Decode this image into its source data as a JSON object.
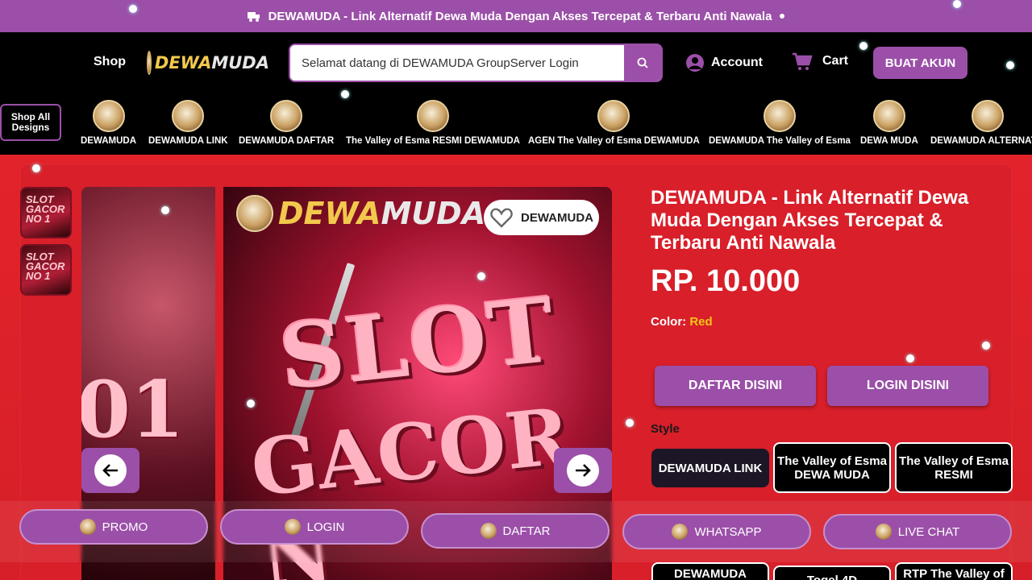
{
  "announcement": {
    "text": "DEWAMUDA - Link Alternatif Dewa Muda Dengan Akses Tercepat & Terbaru Anti Nawala"
  },
  "header": {
    "shop_label": "Shop",
    "logo": {
      "part1": "DEWA",
      "part2": "MUDA"
    },
    "search": {
      "value": "Selamat datang di DEWAMUDA GroupServer Login"
    },
    "account_label": "Account",
    "cart_label": "Cart",
    "cta_label": "BUAT AKUN"
  },
  "categories": {
    "shop_all": "Shop All Designs",
    "items": [
      {
        "label": "DEWAMUDA"
      },
      {
        "label": "DEWAMUDA LINK"
      },
      {
        "label": "DEWAMUDA DAFTAR"
      },
      {
        "label": "The Valley of Esma RESMI DEWAMUDA"
      },
      {
        "label": "AGEN The Valley of Esma DEWAMUDA"
      },
      {
        "label": "DEWAMUDA The Valley of Esma"
      },
      {
        "label": "DEWA MUDA"
      },
      {
        "label": "DEWAMUDA ALTERNATIF"
      }
    ]
  },
  "gallery": {
    "thumb_text": "SLOT GACOR NO 1",
    "banner_brand": {
      "part1": "DEWA",
      "part2": "MUDA"
    },
    "banner_text1": "SLOT",
    "banner_text2": "GACOR N",
    "left_text": "01",
    "wishlist_label": "DEWAMUDA"
  },
  "product": {
    "title": "DEWAMUDA - Link Alternatif Dewa Muda Dengan Akses Tercepat & Terbaru Anti Nawala",
    "price": "RP. 10.000",
    "color_label": "Color:",
    "color_value": "Red",
    "daftar_label": "DAFTAR DISINI",
    "login_label": "LOGIN DISINI",
    "style_label": "Style",
    "styles": [
      {
        "label": "DEWAMUDA LINK"
      },
      {
        "label": "The Valley of Esma DEWA MUDA"
      },
      {
        "label": "The Valley of Esma RESMI"
      },
      {
        "label": "DEWAMUDA"
      },
      {
        "label": "Togel 4D"
      },
      {
        "label": "RTP The Valley of"
      }
    ]
  },
  "bottom_bar": [
    {
      "label": "PROMO"
    },
    {
      "label": "LOGIN"
    },
    {
      "label": "DAFTAR"
    },
    {
      "label": "WHATSAPP"
    },
    {
      "label": "LIVE CHAT"
    }
  ],
  "colors": {
    "accent": "#9b4fa8",
    "main_bg": "#d81f2a",
    "header_bg": "#000000",
    "color_value": "#f5c518"
  }
}
